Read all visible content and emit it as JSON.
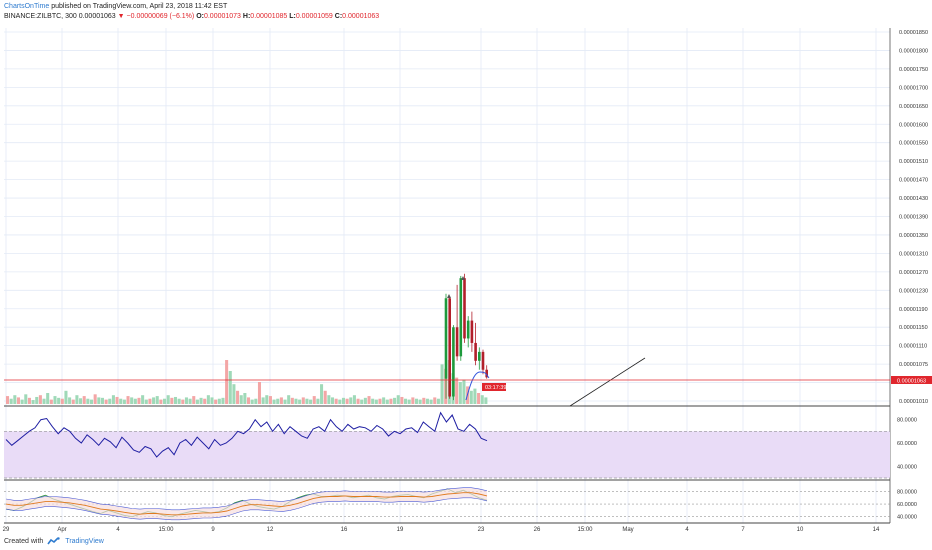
{
  "header": {
    "author": "ChartsOnTime",
    "published_text": "published on TradingView.com, April 23, 2018 11:42 EST",
    "symbol": "BINANCE:ZILBTC, 300",
    "last_price": "0.00001063",
    "change": "▼ −0.00000069 (−6.1%)",
    "o_label": "O:",
    "o_value": "0.00001073",
    "h_label": "H:",
    "h_value": "0.00001085",
    "l_label": "L:",
    "l_value": "0.00001059",
    "c_label": "C:",
    "c_value": "0.00001063"
  },
  "footer": {
    "created_with": "Created with",
    "brand": "TradingView"
  },
  "colors": {
    "up": "#26a69a",
    "down": "#ef5350",
    "vol_up": "#9fd9b8",
    "vol_down": "#f3a6a6",
    "rsi_line": "#1f1fa3",
    "rsi_band": "#e9dcf7",
    "grid": "#e3eaf6",
    "price_line": "#e0262d",
    "axis": "#333333"
  },
  "chart_data": [
    {
      "type": "candlestick",
      "title": "",
      "x_ticks": [
        "29",
        "Apr",
        "4",
        "15:00",
        "9",
        "12",
        "16",
        "19",
        "23",
        "26",
        "15:00",
        "May",
        "4",
        "7",
        "10",
        "14"
      ],
      "y_ticks": [
        "0.00001850",
        "0.00001800",
        "0.00001750",
        "0.00001700",
        "0.00001650",
        "0.00001600",
        "0.00001550",
        "0.00001510",
        "0.00001470",
        "0.00001430",
        "0.00001390",
        "0.00001350",
        "0.00001310",
        "0.00001270",
        "0.00001230",
        "0.00001190",
        "0.00001150",
        "0.00001110",
        "0.00001075",
        "0.00001063",
        "0.00001010"
      ],
      "ylim": [
        1.01e-05,
        1.87e-05
      ],
      "last_price_label": "0.00001063",
      "countdown_label": "03:17:39",
      "candles": [
        {
          "o": 1.06e-05,
          "h": 1.25e-05,
          "l": 1.015e-05,
          "c": 1.24e-05
        },
        {
          "o": 1.24e-05,
          "h": 1.245e-05,
          "l": 1.015e-05,
          "c": 1.02e-05
        },
        {
          "o": 1.02e-05,
          "h": 1.18e-05,
          "l": 1.012e-05,
          "c": 1.175e-05
        },
        {
          "o": 1.175e-05,
          "h": 1.27e-05,
          "l": 1.1e-05,
          "c": 1.11e-05
        },
        {
          "o": 1.11e-05,
          "h": 1.29e-05,
          "l": 1.1e-05,
          "c": 1.285e-05
        },
        {
          "o": 1.285e-05,
          "h": 1.295e-05,
          "l": 1.14e-05,
          "c": 1.15e-05
        },
        {
          "o": 1.15e-05,
          "h": 1.2e-05,
          "l": 1.13e-05,
          "c": 1.19e-05
        },
        {
          "o": 1.19e-05,
          "h": 1.21e-05,
          "l": 1.12e-05,
          "c": 1.14e-05
        },
        {
          "o": 1.14e-05,
          "h": 1.185e-05,
          "l": 1.09e-05,
          "c": 1.1e-05
        },
        {
          "o": 1.1e-05,
          "h": 1.13e-05,
          "l": 1.08e-05,
          "c": 1.12e-05
        },
        {
          "o": 1.12e-05,
          "h": 1.125e-05,
          "l": 1.07e-05,
          "c": 1.08e-05
        },
        {
          "o": 1.08e-05,
          "h": 1.09e-05,
          "l": 1.06e-05,
          "c": 1.063e-05
        }
      ],
      "volume_relative": [
        0.18,
        0.12,
        0.2,
        0.15,
        0.1,
        0.22,
        0.14,
        0.09,
        0.16,
        0.2,
        0.12,
        0.25,
        0.1,
        0.18,
        0.14,
        0.12,
        0.3,
        0.15,
        0.1,
        0.2,
        0.13,
        0.18,
        0.12,
        0.1,
        0.22,
        0.15,
        0.14,
        0.1,
        0.12,
        0.2,
        0.16,
        0.12,
        0.1,
        0.18,
        0.15,
        0.12,
        0.14,
        0.2,
        0.1,
        0.12,
        0.15,
        0.18,
        0.1,
        0.12,
        0.2,
        0.14,
        0.16,
        0.12,
        0.1,
        0.15,
        0.12,
        0.18,
        0.1,
        0.14,
        0.12,
        0.2,
        0.15,
        0.1,
        0.12,
        0.14,
        1.0,
        0.75,
        0.45,
        0.3,
        0.2,
        0.25,
        0.15,
        0.1,
        0.12,
        0.5,
        0.15,
        0.2,
        0.18,
        0.1,
        0.12,
        0.15,
        0.1,
        0.2,
        0.14,
        0.12,
        0.1,
        0.15,
        0.12,
        0.1,
        0.18,
        0.12,
        0.45,
        0.3,
        0.2,
        0.15,
        0.12,
        0.1,
        0.14,
        0.12,
        0.15,
        0.2,
        0.12,
        0.1,
        0.14,
        0.18,
        0.12,
        0.1,
        0.12,
        0.15,
        0.1,
        0.12,
        0.14,
        0.2,
        0.16,
        0.12,
        0.1,
        0.15,
        0.12,
        0.1,
        0.14,
        0.12,
        0.1,
        0.15,
        0.12,
        0.9,
        0.8,
        1.0,
        0.7,
        0.6,
        0.5,
        0.55,
        0.4,
        0.3,
        0.35,
        0.25,
        0.2,
        0.15
      ]
    },
    {
      "type": "line",
      "title": "",
      "y_ticks": [
        "80.0000",
        "60.0000",
        "40.0000"
      ],
      "ylim": [
        30,
        90
      ],
      "band": [
        30,
        70
      ],
      "values": [
        63,
        58,
        62,
        66,
        70,
        73,
        80,
        81,
        74,
        68,
        73,
        70,
        64,
        60,
        67,
        63,
        58,
        64,
        61,
        56,
        65,
        60,
        54,
        52,
        57,
        55,
        48,
        53,
        56,
        50,
        60,
        63,
        58,
        65,
        60,
        55,
        63,
        58,
        60,
        64,
        70,
        68,
        72,
        80,
        74,
        78,
        70,
        76,
        68,
        74,
        70,
        66,
        64,
        72,
        74,
        70,
        80,
        74,
        70,
        76,
        72,
        74,
        73,
        70,
        75,
        72,
        66,
        70,
        68,
        72,
        73,
        69,
        78,
        74,
        70,
        86,
        78,
        84,
        72,
        70,
        76,
        72,
        64,
        62
      ]
    },
    {
      "type": "line",
      "title": "",
      "y_ticks": [
        "80.0000",
        "60.0000",
        "40.0000"
      ],
      "ylim": [
        30,
        95
      ],
      "series": [
        {
          "values": [
            52,
            50,
            55,
            62,
            70,
            74,
            68,
            64,
            60,
            56,
            52,
            48,
            45,
            50,
            46,
            42,
            40,
            44,
            48,
            46,
            42,
            40,
            44,
            47,
            50,
            48,
            46,
            48,
            54,
            62,
            66,
            60,
            56,
            54,
            52,
            56,
            64,
            70,
            74,
            76,
            72,
            72,
            74,
            73,
            70,
            72,
            74,
            70,
            68,
            72,
            74,
            75,
            72,
            70,
            76,
            80,
            84,
            78,
            82,
            76,
            70,
            66
          ]
        },
        {
          "values": [
            60,
            58,
            58,
            60,
            62,
            64,
            64,
            63,
            62,
            60,
            58,
            55,
            52,
            51,
            49,
            47,
            45,
            44,
            45,
            45,
            44,
            43,
            43,
            44,
            45,
            46,
            46,
            47,
            49,
            53,
            57,
            59,
            59,
            58,
            57,
            56,
            58,
            61,
            65,
            69,
            71,
            72,
            72,
            73,
            72,
            72,
            72,
            72,
            71,
            71,
            72,
            72,
            72,
            71,
            72,
            74,
            76,
            77,
            78,
            78,
            76,
            73
          ]
        }
      ]
    }
  ]
}
